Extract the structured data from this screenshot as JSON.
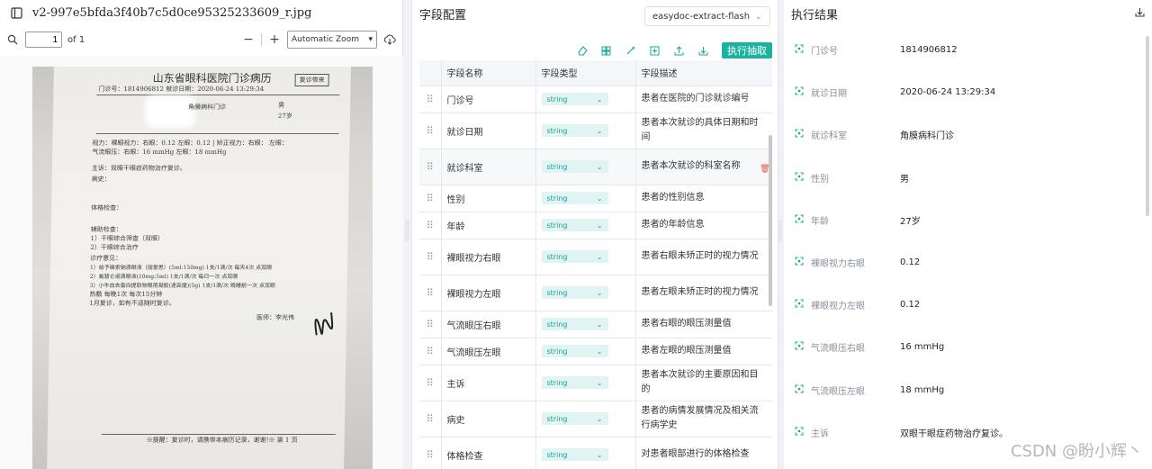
{
  "pdf": {
    "file_name": "v2-997e5bfda3f40b7c5d0ce95325233609_r.jpg",
    "page_value": "1",
    "page_total": "of 1",
    "zoom": "Automatic Zoom",
    "document": {
      "title": "山东省眼科医院门诊病历",
      "tag": "复诊带来",
      "visit_line": "门诊号：1814906812    就诊日期：2020-06-24 13:29:34",
      "dept": "角膜病科门诊",
      "gender": "男",
      "age": "27岁",
      "lines": [
        "视力：裸眼视力：右眼：0.12  左眼：0.12 | 矫正视力：右眼：  左眼：",
        "气流眼压：右眼：16 mmHg    左眼：18 mmHg",
        "主诉：双眼干眼症药物治疗复诊。",
        "病史：",
        "体格检查：",
        "辅助检查：",
        "1）干眼综合筛查（双眼）",
        "2）干眼综合治疗",
        "诊疗意见：",
        "1）给予磷索钠滴眼液（丽爱思）(5ml:150mg) 1支/1滴/次 每天4次 点双眼",
        "2）氟替仑诺滴眼液(10mg:5ml) 1支/1滴/次 每日一次 点双眼",
        "3）小牛血去蛋白提取物眼用凝胶(速高捷)(5g) 1支/1滴/次 晚睡前一次 点双眼",
        "热敷 每晚1次 每次15分钟",
        "1月复诊，如有不适随时复诊。"
      ],
      "doctor": "医师：李光伟",
      "footer": "※提醒：复诊时，请携带本病历记录，谢谢!※ 第 1 页"
    }
  },
  "config": {
    "title": "字段配置",
    "model": "easydoc-extract-flash",
    "run_label": "执行抽取",
    "columns": [
      "字段名称",
      "字段类型",
      "字段描述"
    ],
    "rows": [
      {
        "name": "门诊号",
        "type": "string",
        "desc": "患者在医院的门诊就诊编号"
      },
      {
        "name": "就诊日期",
        "type": "string",
        "desc": "患者本次就诊的具体日期和时间"
      },
      {
        "name": "就诊科室",
        "type": "string",
        "desc": "患者本次就诊的科室名称"
      },
      {
        "name": "性别",
        "type": "string",
        "desc": "患者的性别信息"
      },
      {
        "name": "年龄",
        "type": "string",
        "desc": "患者的年龄信息"
      },
      {
        "name": "裸眼视力右眼",
        "type": "string",
        "desc": "患者右眼未矫正时的视力情况"
      },
      {
        "name": "裸眼视力左眼",
        "type": "string",
        "desc": "患者左眼未矫正时的视力情况"
      },
      {
        "name": "气流眼压右眼",
        "type": "string",
        "desc": "患者右眼的眼压测量值"
      },
      {
        "name": "气流眼压左眼",
        "type": "string",
        "desc": "患者左眼的眼压测量值"
      },
      {
        "name": "主诉",
        "type": "string",
        "desc": "患者本次就诊的主要原因和目的"
      },
      {
        "name": "病史",
        "type": "string",
        "desc": "患者的病情发展情况及相关流行病学史"
      },
      {
        "name": "体格检查",
        "type": "string",
        "desc": "对患者眼部进行的体格检查"
      }
    ]
  },
  "results": {
    "title": "执行结果",
    "items": [
      {
        "label": "门诊号",
        "value": "1814906812"
      },
      {
        "label": "就诊日期",
        "value": "2020-06-24 13:29:34"
      },
      {
        "label": "就诊科室",
        "value": "角膜病科门诊"
      },
      {
        "label": "性别",
        "value": "男"
      },
      {
        "label": "年龄",
        "value": "27岁"
      },
      {
        "label": "裸眼视力右眼",
        "value": "0.12"
      },
      {
        "label": "裸眼视力左眼",
        "value": "0.12"
      },
      {
        "label": "气流眼压右眼",
        "value": "16 mmHg"
      },
      {
        "label": "气流眼压左眼",
        "value": "18 mmHg"
      },
      {
        "label": "主诉",
        "value": "双眼干眼症药物治疗复诊。"
      }
    ]
  },
  "watermark": "CSDN @盼小辉丶",
  "colors": {
    "accent": "#1bb3a0",
    "pill_bg": "#dff4f3",
    "delete": "#e05050"
  }
}
